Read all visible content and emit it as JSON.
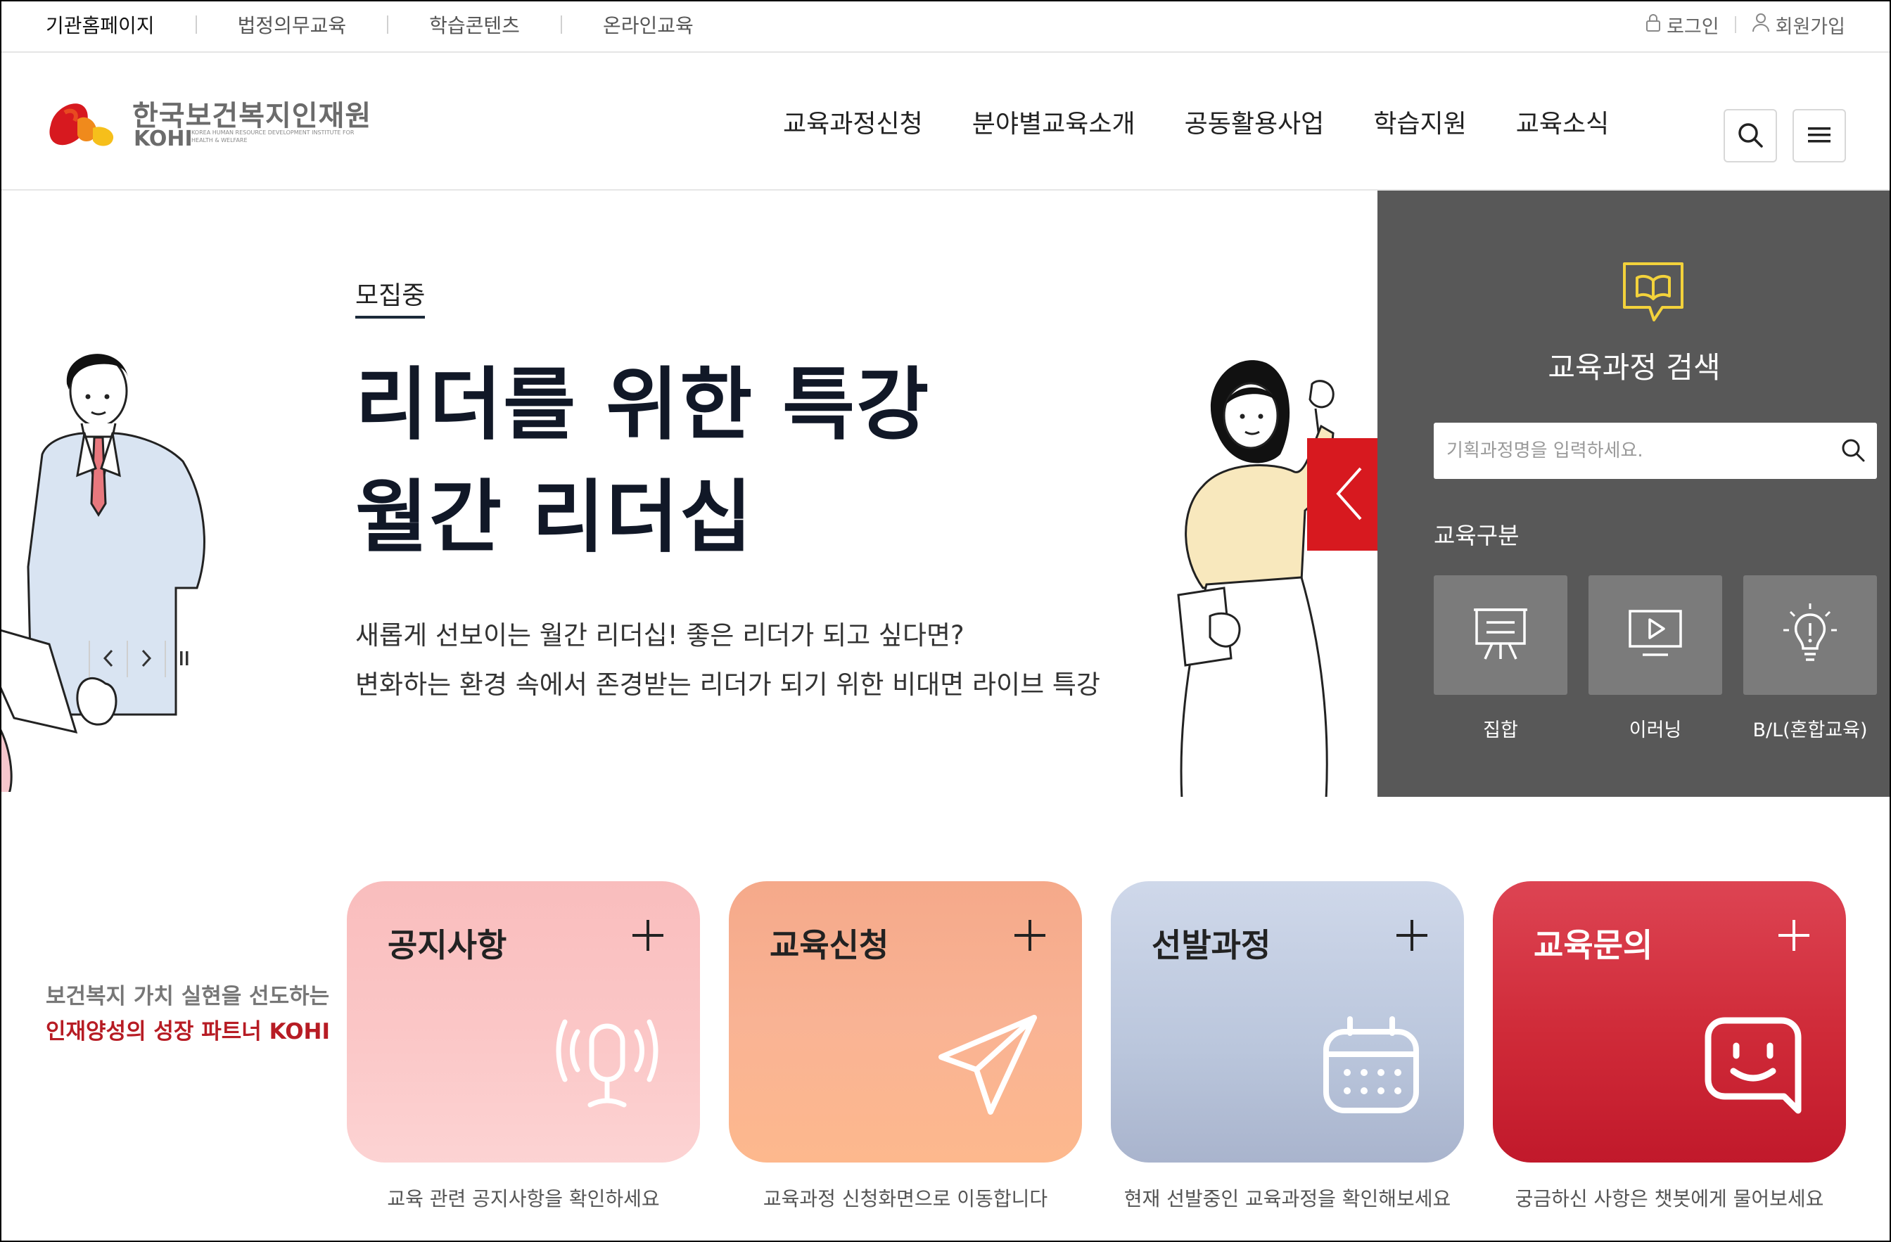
{
  "util_nav": {
    "items": [
      "기관홈페이지",
      "법정의무교육",
      "학습콘텐츠",
      "온라인교육"
    ],
    "login": "로그인",
    "signup": "회원가입"
  },
  "header": {
    "logo_ko": "한국보건복지인재원",
    "logo_en": "KOHI",
    "logo_en_sub": "KOREA HUMAN RESOURCE DEVELOPMENT INSTITUTE FOR HEALTH & WELFARE",
    "menu": [
      "교육과정신청",
      "분야별교육소개",
      "공동활용사업",
      "학습지원",
      "교육소식"
    ],
    "search_icon": "search-icon",
    "menu_icon": "hamburger-icon"
  },
  "hero": {
    "badge": "모집중",
    "title_line1": "리더를 위한 특강",
    "title_line2": "월간 리더십",
    "desc_line1": "새롭게 선보이는 월간 리더십! 좋은 리더가 되고 싶다면?",
    "desc_line2": "변화하는 환경 속에서 존경받는 리더가 되기 위한 비대면 라이브 특강"
  },
  "search_panel": {
    "title": "교육과정 검색",
    "placeholder": "기획과정명을 입력하세요.",
    "category_label": "교육구분",
    "categories": [
      {
        "label": "집합",
        "icon": "lecture-board-icon"
      },
      {
        "label": "이러닝",
        "icon": "monitor-play-icon"
      },
      {
        "label": "B/L(혼합교육)",
        "icon": "lightbulb-icon"
      }
    ]
  },
  "slogan": {
    "line1": "보건복지 가치 실현을 선도하는",
    "line2": "인재양성의 성장 파트너 KOHI"
  },
  "cards": [
    {
      "title": "공지사항",
      "desc": "교육 관련 공지사항을 확인하세요",
      "icon": "microphone-icon"
    },
    {
      "title": "교육신청",
      "desc": "교육과정 신청화면으로 이동합니다",
      "icon": "paper-plane-icon"
    },
    {
      "title": "선발과정",
      "desc": "현재 선발중인 교육과정을 확인해보세요",
      "icon": "calendar-icon"
    },
    {
      "title": "교육문의",
      "desc": "궁금하신 사항은 챗봇에게 물어보세요",
      "icon": "chatbot-icon"
    }
  ],
  "colors": {
    "brand_red": "#d7191f",
    "panel_bg": "#585858",
    "slogan_red": "#b71c24"
  }
}
